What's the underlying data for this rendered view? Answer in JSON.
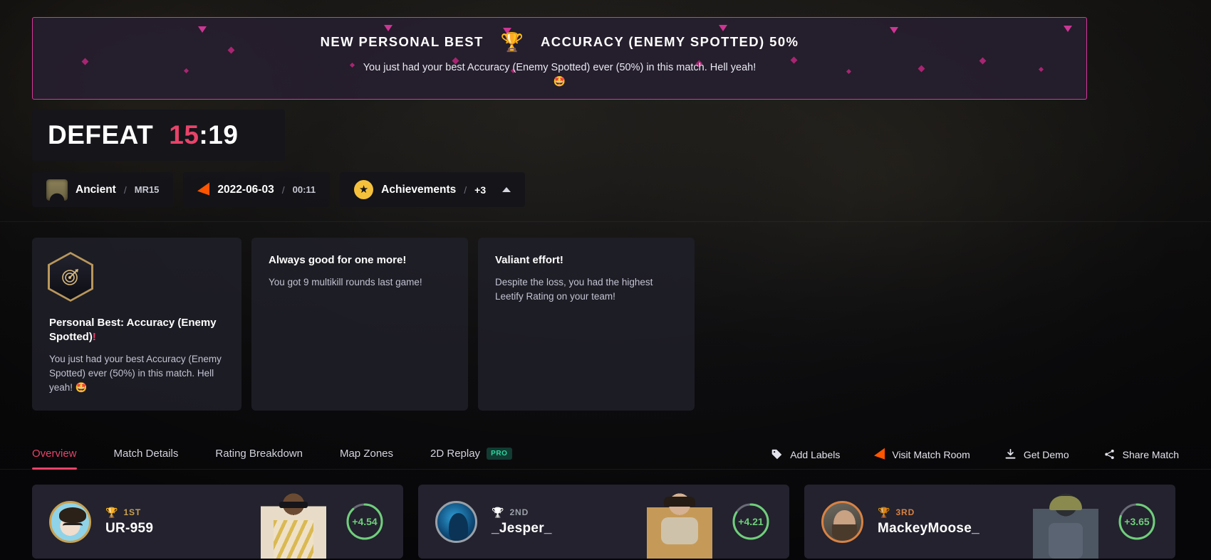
{
  "banner": {
    "title": "NEW PERSONAL BEST",
    "trophy_icon": "trophy-icon",
    "stat": "ACCURACY (ENEMY SPOTTED) 50%",
    "description": "You just had your best Accuracy (Enemy Spotted) ever (50%) in this match. Hell yeah!",
    "emoji": "🤩",
    "border_color": "#d6389a"
  },
  "score": {
    "result": "DEFEAT",
    "team_score": "15",
    "separator": ":",
    "opponent_score": "19",
    "result_color": "#ffffff",
    "team_score_color": "#e8436a"
  },
  "meta": {
    "map": "Ancient",
    "map_icon": "ancient-map-icon",
    "mode": "MR15",
    "date": "2022-06-03",
    "duration": "00:11",
    "faceit_icon": "faceit-arrow-icon",
    "achievements_label": "Achievements",
    "achievements_count": "+3",
    "achievements_icon": "star-icon",
    "collapse_icon": "chevron-up-icon",
    "slash": "/"
  },
  "achievements": [
    {
      "icon": "target-bullseye-icon",
      "name": "Personal Best: Accuracy (Enemy Spotted)",
      "bang": "!",
      "description": "You just had your best Accuracy (Enemy Spotted) ever (50%) in this match. Hell yeah! 🤩"
    },
    {
      "icon": "",
      "name": "Always good for one more!",
      "bang": "",
      "description": "You got 9 multikill rounds last game!"
    },
    {
      "icon": "",
      "name": "Valiant effort!",
      "bang": "",
      "description": "Despite the loss, you had the highest Leetify Rating on your team!"
    }
  ],
  "tabs": [
    {
      "label": "Overview",
      "active": true,
      "badge": ""
    },
    {
      "label": "Match Details",
      "active": false,
      "badge": ""
    },
    {
      "label": "Rating Breakdown",
      "active": false,
      "badge": ""
    },
    {
      "label": "Map Zones",
      "active": false,
      "badge": ""
    },
    {
      "label": "2D Replay",
      "active": false,
      "badge": "PRO"
    }
  ],
  "actions": [
    {
      "label": "Add Labels",
      "icon": "tag-icon"
    },
    {
      "label": "Visit Match Room",
      "icon": "faceit-arrow-icon"
    },
    {
      "label": "Get Demo",
      "icon": "download-icon"
    },
    {
      "label": "Share Match",
      "icon": "share-icon"
    }
  ],
  "players": [
    {
      "name": "UR-959",
      "rank": "1ST",
      "trophy": "🏆",
      "rating": "+4.54",
      "ring_pct": 88,
      "medal": "gold"
    },
    {
      "name": "_Jesper_",
      "rank": "2ND",
      "trophy": "🏆",
      "rating": "+4.21",
      "ring_pct": 84,
      "medal": "silver"
    },
    {
      "name": "MackeyMoose_",
      "rank": "3RD",
      "trophy": "🏆",
      "rating": "+3.65",
      "ring_pct": 80,
      "medal": "bronze"
    }
  ],
  "colors": {
    "accent_pink": "#e8436a",
    "banner_magenta": "#d6389a",
    "faceit_orange": "#ff5500",
    "gold": "#c9a253",
    "green": "#6fcf7b",
    "pro_green": "#2fd6a0"
  }
}
